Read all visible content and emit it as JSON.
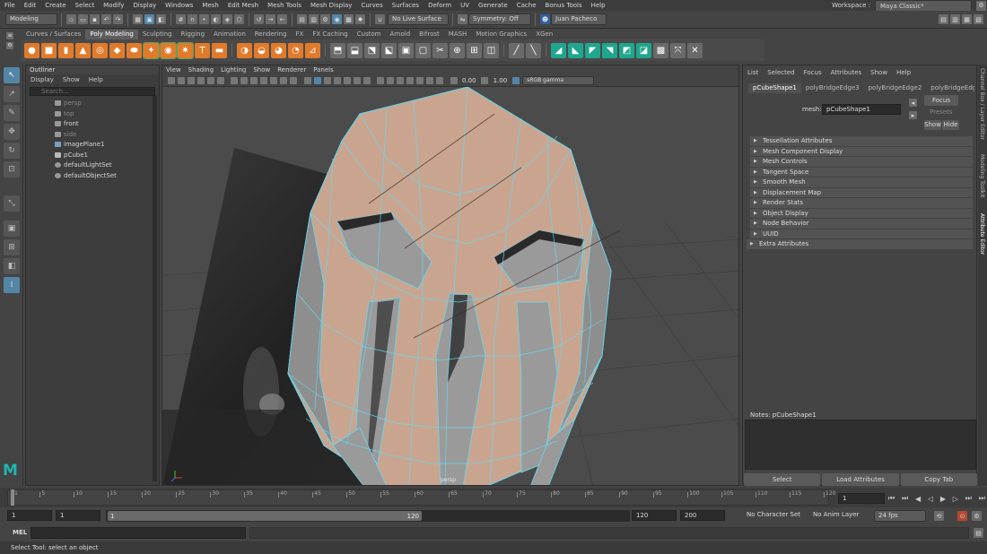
{
  "menubar": {
    "items": [
      "File",
      "Edit",
      "Create",
      "Select",
      "Modify",
      "Display",
      "Windows",
      "Mesh",
      "Edit Mesh",
      "Mesh Tools",
      "Mesh Display",
      "Curves",
      "Surfaces",
      "Deform",
      "UV",
      "Generate",
      "Cache",
      "Bonus Tools",
      "Help"
    ],
    "workspace_label": "Workspace :",
    "workspace_value": "Maya Classic*"
  },
  "statusline": {
    "mode": "Modeling",
    "live_surface": "No Live Surface",
    "symmetry": "Symmetry: Off",
    "user": "Juan Pacheco"
  },
  "shelf": {
    "tabs": [
      "Curves / Surfaces",
      "Poly Modeling",
      "Sculpting",
      "Rigging",
      "Animation",
      "Rendering",
      "FX",
      "FX Caching",
      "Custom",
      "Arnold",
      "Bifrost",
      "MASH",
      "Motion Graphics",
      "XGen"
    ],
    "active_tab": "Poly Modeling"
  },
  "outliner": {
    "title": "Outliner",
    "menu": [
      "Display",
      "Show",
      "Help"
    ],
    "search_placeholder": "Search...",
    "items": [
      {
        "label": "persp",
        "dim": true
      },
      {
        "label": "top",
        "dim": true
      },
      {
        "label": "front",
        "dim": false
      },
      {
        "label": "side",
        "dim": true
      },
      {
        "label": "imagePlane1",
        "dim": false
      },
      {
        "label": "pCube1",
        "dim": false
      },
      {
        "label": "defaultLightSet",
        "dim": false
      },
      {
        "label": "defaultObjectSet",
        "dim": false
      }
    ]
  },
  "viewport": {
    "menu": [
      "View",
      "Shading",
      "Lighting",
      "Show",
      "Renderer",
      "Panels"
    ],
    "exposure": "0.00",
    "gamma": "1.00",
    "color_space": "sRGB gamma",
    "camera_label": "persp"
  },
  "attribute_editor": {
    "menu": [
      "List",
      "Selected",
      "Focus",
      "Attributes",
      "Show",
      "Help"
    ],
    "tabs": [
      "pCubeShape1",
      "polyBridgeEdge3",
      "polyBridgeEdge2",
      "polyBridgeEdg"
    ],
    "active_tab": "pCubeShape1",
    "mesh_label": "mesh:",
    "mesh_value": "pCubeShape1",
    "focus_button": "Focus",
    "presets_button": "Presets",
    "show_button": "Show",
    "hide_button": "Hide",
    "sections": [
      "Tessellation Attributes",
      "Mesh Component Display",
      "Mesh Controls",
      "Tangent Space",
      "Smooth Mesh",
      "Displacement Map",
      "Render Stats",
      "Object Display",
      "Node Behavior",
      "UUID",
      "Extra Attributes"
    ],
    "notes_label": "Notes:  pCubeShape1",
    "select_button": "Select",
    "load_attributes_button": "Load Attributes",
    "copy_tab_button": "Copy Tab"
  },
  "right_tabs": [
    "Channel Box / Layer Editor",
    "Modeling Toolkit",
    "Attribute Editor"
  ],
  "timeslider": {
    "ticks": [
      "1",
      "5",
      "10",
      "15",
      "20",
      "25",
      "30",
      "35",
      "40",
      "45",
      "50",
      "55",
      "60",
      "65",
      "70",
      "75",
      "80",
      "85",
      "90",
      "95",
      "100",
      "105",
      "110",
      "115",
      "120"
    ],
    "current_frame": "1"
  },
  "range": {
    "start": "1",
    "playback_start": "1",
    "slider_start": "1",
    "slider_end": "120",
    "playback_end": "120",
    "end": "200",
    "character_set": "No Character Set",
    "anim_layer": "No Anim Layer",
    "fps": "24 fps"
  },
  "command_line": {
    "label": "MEL"
  },
  "help_line": {
    "text": "Select Tool: select an object"
  }
}
